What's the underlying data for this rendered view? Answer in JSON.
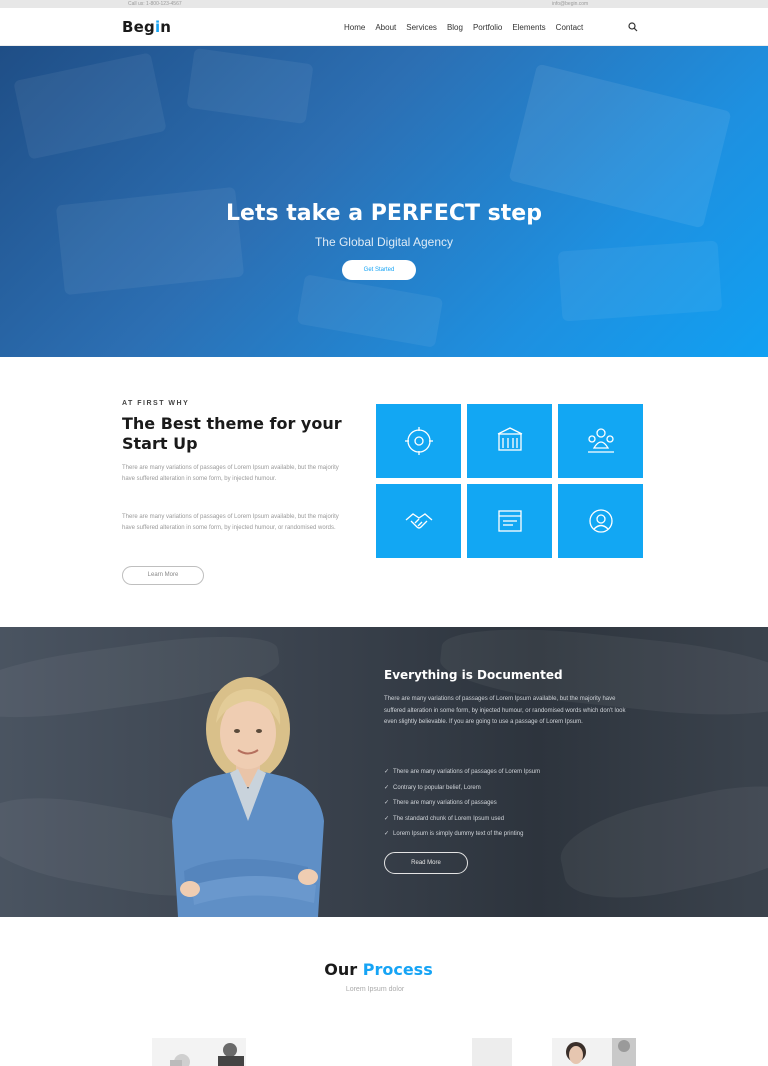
{
  "topbar": {
    "left_text": "Call us: 1-800-123-4567",
    "right_text": "info@begin.com"
  },
  "header": {
    "logo_main": "Beg",
    "logo_accent": "i",
    "logo_end": "n",
    "nav": [
      "Home",
      "About",
      "Services",
      "Blog",
      "Portfolio",
      "Elements",
      "Contact"
    ]
  },
  "hero": {
    "title": "Lets take a PERFECT step",
    "subtitle": "The Global Digital Agency",
    "button_label": "Get Started"
  },
  "about": {
    "kicker": "AT FIRST WHY",
    "title": "The Best theme for your Start Up",
    "paragraph_1": "There are many variations of passages of Lorem Ipsum available, but the majority have suffered alteration in some form, by injected humour.",
    "paragraph_2": "There are many variations of passages of Lorem Ipsum available, but the majority have suffered alteration in some form, by injected humour, or randomised words.",
    "button_label": "Learn More",
    "tiles": [
      {
        "icon": "settings-globe-icon"
      },
      {
        "icon": "building-icon"
      },
      {
        "icon": "team-icon"
      },
      {
        "icon": "handshake-icon"
      },
      {
        "icon": "browser-icon"
      },
      {
        "icon": "support-icon"
      }
    ]
  },
  "documented": {
    "title": "Everything is Documented",
    "text": "There are many variations of passages of Lorem Ipsum available, but the majority have suffered alteration in some form, by injected humour, or randomised words which don't look even slightly believable. If you are going to use a passage of Lorem Ipsum.",
    "list": [
      "There are many variations of passages of Lorem Ipsum",
      "Contrary to popular belief, Lorem",
      "There are many variations of passages",
      "The standard chunk of Lorem Ipsum used",
      "Lorem Ipsum is simply dummy text of the printing"
    ],
    "button_label": "Read More"
  },
  "process": {
    "title_main": "Our",
    "title_accent": "Process",
    "subtitle": "Lorem Ipsum dolor"
  },
  "colors": {
    "accent": "#16a4f5",
    "tile": "#12a7f3",
    "dark_section": "#3a424d"
  }
}
